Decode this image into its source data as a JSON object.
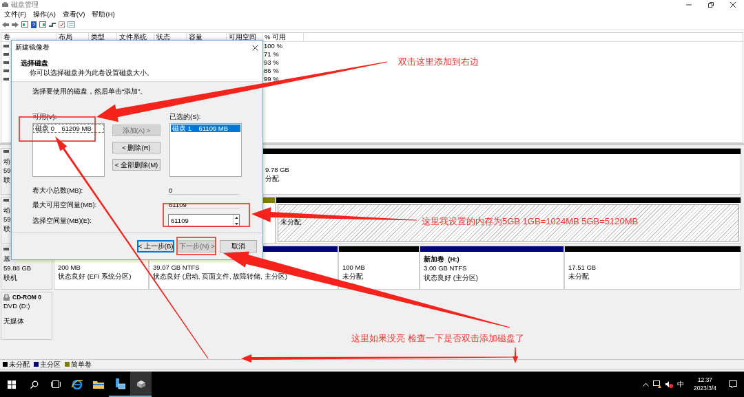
{
  "window": {
    "title": "磁盘管理",
    "menu": [
      "文件(F)",
      "操作(A)",
      "查看(V)",
      "帮助(H)"
    ]
  },
  "volume_list": {
    "columns": [
      "卷",
      "布局",
      "类型",
      "文件系统",
      "状态",
      "容量",
      "可用空间",
      "% 可用"
    ],
    "rows": [
      {
        "free_percent": "100 %"
      },
      {
        "free_percent": "71 %"
      },
      {
        "free_percent": "93 %"
      },
      {
        "free_percent": "86 %"
      },
      {
        "free_percent": "99 %"
      }
    ]
  },
  "disks": [
    {
      "kind": "disk",
      "lines": [
        "动",
        "59",
        "联"
      ],
      "partitions": [
        {
          "color": "#000000",
          "selected": false,
          "lines": [
            "9.78 GB",
            "分配"
          ]
        }
      ]
    },
    {
      "kind": "disk",
      "lines": [
        "动",
        "59",
        "联"
      ],
      "partitions": [
        {
          "color": "#808000",
          "selected": false
        },
        {
          "color": "#000000",
          "selected": true,
          "lines": [
            "未分配"
          ]
        }
      ]
    },
    {
      "kind": "disk",
      "lines": [
        "基",
        "59.88 GB",
        "联机"
      ],
      "partitions": [
        {
          "selected": false,
          "lines": [
            "200 MB",
            "状态良好 (EFI 系统分区)"
          ]
        },
        {
          "color": "#000080",
          "selected": false,
          "lines": [
            "39.07 GB NTFS",
            "状态良好 (启动, 页面文件, 故障转储, 主分区)"
          ]
        },
        {
          "color": "#000000",
          "selected": false,
          "lines": [
            "100 MB",
            "未分配"
          ]
        },
        {
          "color": "#000080",
          "selected": false,
          "name": "新加卷  (H:)",
          "lines": [
            "3.00 GB NTFS",
            "状态良好 (主分区)"
          ]
        },
        {
          "color": "#000000",
          "selected": false,
          "lines": [
            "17.51 GB",
            "未分配"
          ]
        }
      ]
    },
    {
      "kind": "cdrom",
      "title": "CD-ROM 0",
      "lines": [
        "DVD (D:)",
        "无媒体"
      ]
    }
  ],
  "legend": [
    {
      "label": "未分配",
      "color": "#000000"
    },
    {
      "label": "主分区",
      "color": "#000080"
    },
    {
      "label": "简单卷",
      "color": "#808000"
    }
  ],
  "dialog": {
    "title": "新建镜像卷",
    "heading": "选择磁盘",
    "subheading": "你可以选择磁盘并为此卷设置磁盘大小。",
    "instruction": "选择要使用的磁盘，然后单击“添加”。",
    "available": {
      "label": "可用(V):",
      "items": [
        {
          "text": "磁盘 0    61209 MB",
          "selected": false
        }
      ]
    },
    "selected_list": {
      "label": "已选的(S):",
      "items": [
        {
          "text": "磁盘 1    61109 MB",
          "selected": true
        }
      ]
    },
    "move_buttons": [
      {
        "label": "添加(A) >",
        "disabled": true
      },
      {
        "label": "< 删除(R)",
        "disabled": false
      },
      {
        "label": "< 全部删除(M)",
        "disabled": false
      }
    ],
    "fields": [
      {
        "label": "卷大小总数(MB):",
        "value": "0",
        "kind": "readonly"
      },
      {
        "label": "最大可用空间量(MB):",
        "value": "61109",
        "kind": "readonly"
      },
      {
        "label": "选择空间量(MB)(E):",
        "value": "61109",
        "kind": "spinner"
      }
    ],
    "buttons": [
      {
        "label": "< 上一步(B)",
        "disabled": false,
        "focused": true
      },
      {
        "label": "下一步(N) >",
        "disabled": true,
        "focused": false
      },
      {
        "label": "取消",
        "disabled": false,
        "focused": false
      }
    ]
  },
  "annotations": [
    "双击这里添加到右边",
    "这里我设置的内存为5GB 1GB=1024MB 5GB=5120MB",
    "这里如果没亮 检查一下是否双击添加磁盘了"
  ],
  "taskbar": {
    "apps": [
      {
        "kind": "start",
        "selected": false
      },
      {
        "kind": "search",
        "selected": false
      },
      {
        "kind": "taskview",
        "selected": false
      },
      {
        "kind": "browser",
        "selected": false
      },
      {
        "kind": "folder",
        "selected": false
      },
      {
        "kind": "server",
        "selected": false
      },
      {
        "kind": "disk",
        "selected": true
      }
    ],
    "ime": "中",
    "time": "12:37",
    "date": "2023/3/4"
  }
}
